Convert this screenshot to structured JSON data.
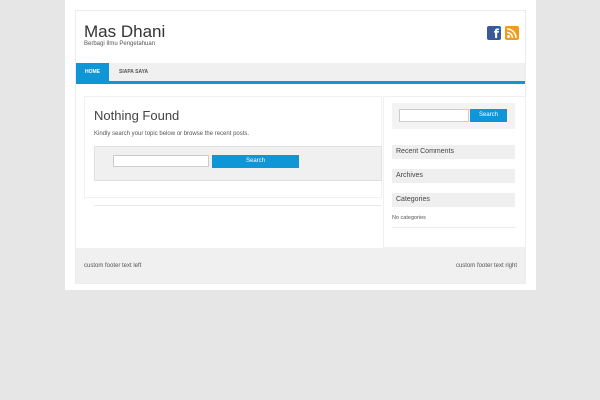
{
  "header": {
    "site_title": "Mas Dhani",
    "site_description": "Berbagi Ilmu Pengetahuan",
    "social_icons": [
      "facebook-icon",
      "rss-icon"
    ]
  },
  "nav": {
    "items": [
      {
        "label": "HOME",
        "active": true
      },
      {
        "label": "SIAPA SAYA",
        "active": false
      }
    ]
  },
  "main": {
    "title": "Nothing Found",
    "intro": "Kindly search your topic below or browse the recent posts.",
    "search_value": "",
    "search_button": "Search"
  },
  "sidebar": {
    "search_value": "",
    "search_button": "Search",
    "widgets": [
      "Recent Comments",
      "Archives",
      "Categories"
    ],
    "no_categories": "No categories"
  },
  "footer": {
    "left": "custom footer text left",
    "right": "custom footer text right"
  },
  "colors": {
    "accent": "#0f96d6",
    "page_bg": "#e6e6e6",
    "panel_bg": "#f0f0f0"
  }
}
